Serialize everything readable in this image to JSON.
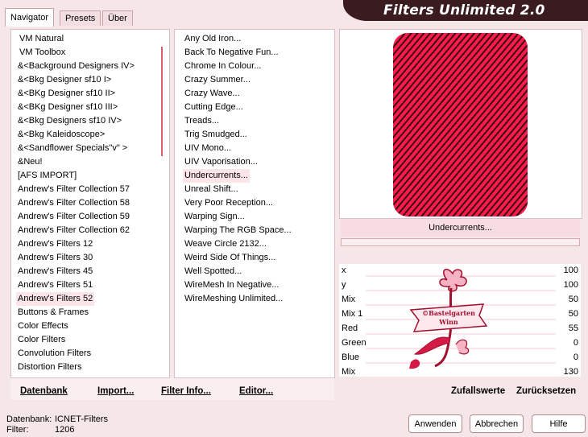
{
  "tabs": [
    "Navigator",
    "Presets",
    "Über"
  ],
  "app_title": "Filters Unlimited 2.0",
  "categories": [
    "VM Natural",
    "VM Toolbox",
    "&<Background Designers IV>",
    "&<Bkg Designer sf10 I>",
    "&<BKg Designer sf10 II>",
    "&<BKg Designer sf10 III>",
    "&<Bkg Designers sf10 IV>",
    "&<Bkg Kaleidoscope>",
    "&<Sandflower Specials\"v\" >",
    "&Neu!",
    "[AFS IMPORT]",
    "Andrew's Filter Collection 57",
    "Andrew's Filter Collection 58",
    "Andrew's Filter Collection 59",
    "Andrew's Filter Collection 62",
    "Andrew's Filters 12",
    "Andrew's Filters 30",
    "Andrew's Filters 45",
    "Andrew's Filters 51",
    "Andrew's Filters 52",
    "Buttons & Frames",
    "Color Effects",
    "Color Filters",
    "Convolution Filters",
    "Distortion Filters"
  ],
  "filters": [
    "Any Old Iron...",
    "Back To Negative Fun...",
    "Chrome In Colour...",
    "Crazy Summer...",
    "Crazy Wave...",
    "Cutting Edge...",
    "Treads...",
    "Trig Smudged...",
    "UIV Mono...",
    "UIV Vaporisation...",
    "Undercurrents...",
    "Unreal Shift...",
    "Very Poor Reception...",
    "Warping Sign...",
    "Warping The RGB Space...",
    "Weave Circle 2132...",
    "Weird Side Of Things...",
    "Well Spotted...",
    "WireMesh In Negative...",
    "WireMeshing Unlimited..."
  ],
  "selected_filter_label": "Undercurrents...",
  "params": [
    {
      "name": "x",
      "value": "100"
    },
    {
      "name": "y",
      "value": "100"
    },
    {
      "name": "Mix",
      "value": "50"
    },
    {
      "name": "Mix 1",
      "value": "50"
    },
    {
      "name": "Red",
      "value": "55"
    },
    {
      "name": "Green",
      "value": "0"
    },
    {
      "name": "Blue",
      "value": "0"
    },
    {
      "name": "Mix",
      "value": "130"
    }
  ],
  "bottom_left": {
    "database": "Datenbank",
    "import": "Import...",
    "filter_info": "Filter Info...",
    "editor": "Editor..."
  },
  "bottom_right": {
    "random": "Zufallswerte",
    "reset": "Zurücksetzen"
  },
  "status": {
    "db_label": "Datenbank:",
    "db_value": "ICNET-Filters",
    "filter_label": "Filter:",
    "filter_value": "1206"
  },
  "buttons": {
    "apply": "Anwenden",
    "cancel": "Abbrechen",
    "help": "Hilfe"
  },
  "watermark": "©Bastelgarten Winn",
  "colors": {
    "accent": "#e15a6b",
    "banner": "#3a1b1f",
    "preview_stripe": "#ff1a4a"
  }
}
